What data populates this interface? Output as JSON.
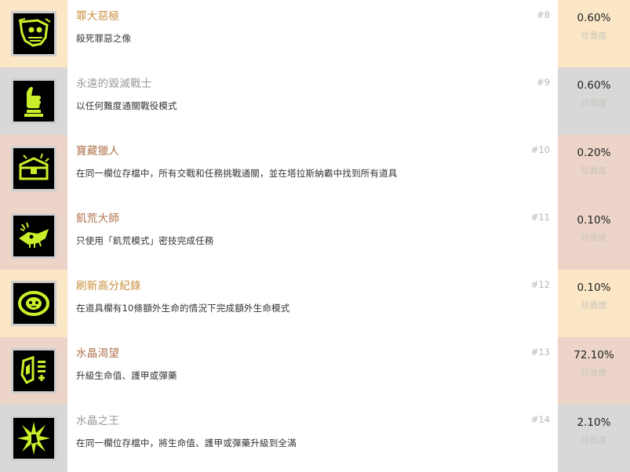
{
  "achievements": [
    {
      "tier": "gold",
      "icon": "skull-banner-icon",
      "title": "罪大惡極",
      "description": "殺死罪惡之像",
      "rank": "#8",
      "percent": "0.60%",
      "rarity_label": "珍貴度"
    },
    {
      "tier": "gray",
      "icon": "thumbs-up-trophy-icon",
      "title": "永遠的毀滅戰士",
      "description": "以任何難度通關戰役模式",
      "rank": "#9",
      "percent": "0.60%",
      "rarity_label": "珍貴度"
    },
    {
      "tier": "bronze",
      "icon": "treasure-chest-icon",
      "title": "寶藏獵人",
      "description": "在同一欄位存檔中，所有交戰和任務挑戰通關，並在塔拉斯納霸中找到所有道具",
      "rank": "#10",
      "percent": "0.20%",
      "rarity_label": "珍貴度"
    },
    {
      "tier": "bronze",
      "icon": "beast-skull-icon",
      "title": "飢荒大師",
      "description": "只使用「飢荒模式」密技完成任務",
      "rank": "#11",
      "percent": "0.10%",
      "rarity_label": "珍貴度"
    },
    {
      "tier": "gold",
      "icon": "skull-ring-icon",
      "title": "刷新高分紀錄",
      "description": "在道具欄有10條額外生命的情況下完成額外生命模式",
      "rank": "#12",
      "percent": "0.10%",
      "rarity_label": "珍貴度"
    },
    {
      "tier": "bronze",
      "icon": "crystal-shield-icon",
      "title": "水晶渴望",
      "description": "升級生命值、護甲或彈藥",
      "rank": "#13",
      "percent": "72.10%",
      "rarity_label": "珍貴度"
    },
    {
      "tier": "gray",
      "icon": "crystal-burst-icon",
      "title": "水晶之王",
      "description": "在同一欄位存檔中，將生命值、護甲或彈藥升級到全滿",
      "rank": "#14",
      "percent": "2.10%",
      "rarity_label": "珍貴度"
    }
  ]
}
